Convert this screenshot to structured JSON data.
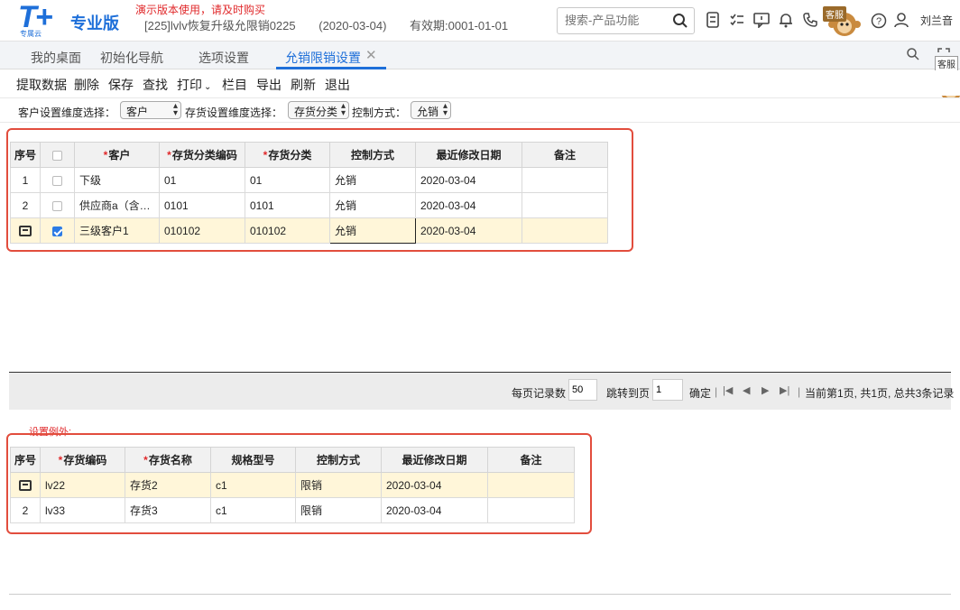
{
  "header": {
    "logo_text": "T+",
    "logo_sub": "专属云",
    "edition": "专业版",
    "demo_notice": "演示版本使用，请及时购买",
    "account": "[225]lvlv恢复升级允限销0225",
    "date": "(2020-03-04)",
    "validity": "有效期:0001-01-01",
    "search_placeholder": "搜索-产品功能",
    "kefu_label": "客服",
    "user_name": "刘兰音"
  },
  "tabs": [
    {
      "label": "我的桌面"
    },
    {
      "label": "初始化导航"
    },
    {
      "label": "选项设置"
    },
    {
      "label": "允销限销设置"
    }
  ],
  "tab_close": "✕",
  "kefu_float_label": "客服",
  "toolbar": {
    "fetch": "提取数据",
    "delete": "删除",
    "save": "保存",
    "find": "查找",
    "print": "打印",
    "columns": "栏目",
    "export": "导出",
    "refresh": "刷新",
    "exit": "退出"
  },
  "filters": {
    "customer_dim_label": "客户设置维度选择：",
    "customer_dim_value": "客户",
    "inventory_dim_label": "存货设置维度选择：",
    "inventory_dim_value": "存货分类",
    "control_label": "控制方式：",
    "control_value": "允销"
  },
  "grid1": {
    "headers": {
      "seq": "序号",
      "customer": "客户",
      "inv_class_code": "存货分类编码",
      "inv_class": "存货分类",
      "control": "控制方式",
      "modified": "最近修改日期",
      "remark": "备注"
    },
    "rows": [
      {
        "seq": "1",
        "customer": "下级",
        "code": "01",
        "cls": "01",
        "control": "允销",
        "modified": "2020-03-04",
        "remark": "",
        "checked": false
      },
      {
        "seq": "2",
        "customer": "供应商a（含…",
        "code": "0101",
        "cls": "0101",
        "control": "允销",
        "modified": "2020-03-04",
        "remark": "",
        "checked": false
      },
      {
        "seq": "",
        "customer": "三级客户1",
        "code": "010102",
        "cls": "010102",
        "control": "允销",
        "modified": "2020-03-04",
        "remark": "",
        "checked": true
      }
    ]
  },
  "pager": {
    "per_page_label": "每页记录数",
    "per_page_value": "50",
    "jump_label": "跳转到页",
    "jump_value": "1",
    "confirm": "确定",
    "status": "当前第1页, 共1页, 总共3条记录"
  },
  "exception_label": "设置例外:",
  "grid2": {
    "headers": {
      "seq": "序号",
      "inv_code": "存货编码",
      "inv_name": "存货名称",
      "spec": "规格型号",
      "control": "控制方式",
      "modified": "最近修改日期",
      "remark": "备注"
    },
    "rows": [
      {
        "seq": "",
        "code": "lv22",
        "name": "存货2",
        "spec": "c1",
        "control": "限销",
        "modified": "2020-03-04",
        "remark": ""
      },
      {
        "seq": "2",
        "code": "lv33",
        "name": "存货3",
        "spec": "c1",
        "control": "限销",
        "modified": "2020-03-04",
        "remark": ""
      }
    ]
  },
  "colors": {
    "brand": "#1e6fd9",
    "notice": "#e0292b",
    "highlight_row": "#fff6d9",
    "annotation_box": "#e24d3d"
  }
}
